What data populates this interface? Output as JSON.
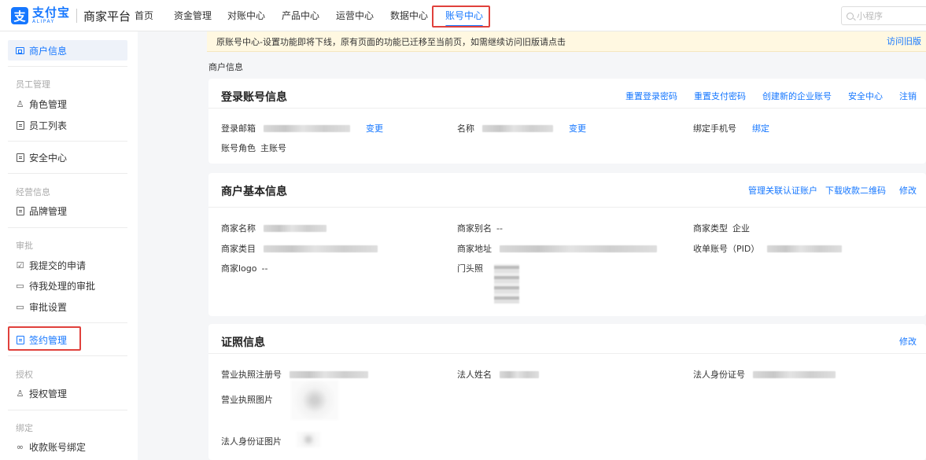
{
  "app": {
    "logo_cn": "支付宝",
    "logo_en": "ALIPAY",
    "platform": "商家平台",
    "logo_glyph": "支"
  },
  "nav": [
    {
      "label": "首页"
    },
    {
      "label": "资金管理"
    },
    {
      "label": "对账中心"
    },
    {
      "label": "产品中心"
    },
    {
      "label": "运营中心"
    },
    {
      "label": "数据中心"
    },
    {
      "label": "账号中心",
      "active": true
    }
  ],
  "search": {
    "placeholder": "小程序"
  },
  "sidebar": {
    "merchant_info": "商户信息",
    "group_staff": "员工管理",
    "role_mgmt": "角色管理",
    "staff_list": "员工列表",
    "security": "安全中心",
    "group_business": "经营信息",
    "brand_mgmt": "品牌管理",
    "group_approval": "审批",
    "my_applications": "我提交的申请",
    "pending_approvals": "待我处理的审批",
    "approval_settings": "审批设置",
    "contract_mgmt": "签约管理",
    "group_auth": "授权",
    "auth_mgmt": "授权管理",
    "group_bind": "绑定",
    "payee_bind": "收款账号绑定"
  },
  "banner": {
    "text": "原账号中心-设置功能即将下线，原有页面的功能已迁移至当前页，如需继续访问旧版请点击",
    "link": "访问旧版"
  },
  "breadcrumb": "商户信息",
  "login_card": {
    "title": "登录账号信息",
    "actions": [
      "重置登录密码",
      "重置支付密码",
      "创建新的企业账号",
      "安全中心",
      "注销"
    ],
    "email_label": "登录邮箱",
    "email_change": "变更",
    "name_label": "名称",
    "name_change": "变更",
    "phone_label": "绑定手机号",
    "phone_bind": "绑定",
    "role_label": "账号角色",
    "role_value": "主账号"
  },
  "basic_card": {
    "title": "商户基本信息",
    "actions": [
      "管理关联认证账户",
      "下载收款二维码",
      "修改"
    ],
    "merchant_name_label": "商家名称",
    "alias_label": "商家别名",
    "alias_value": "--",
    "type_label": "商家类型",
    "type_value": "企业",
    "category_label": "商家类目",
    "address_label": "商家地址",
    "pid_label": "收单账号（PID）",
    "logo_label": "商家logo",
    "logo_value": "--",
    "storefront_label": "门头照"
  },
  "license_card": {
    "title": "证照信息",
    "action": "修改",
    "license_no_label": "营业执照注册号",
    "legal_name_label": "法人姓名",
    "legal_id_label": "法人身份证号",
    "license_img_label": "营业执照图片",
    "id_img_label": "法人身份证图片"
  }
}
